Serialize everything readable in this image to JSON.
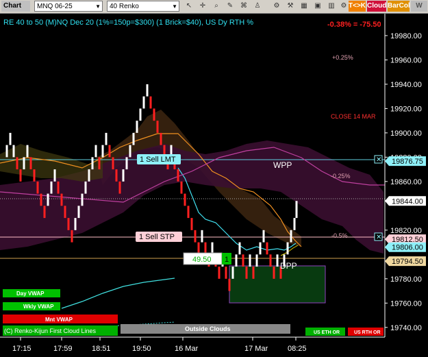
{
  "toolbar": {
    "title": "Chart",
    "symbol": "MNQ 06-25",
    "bar_type": "40 Renko",
    "chips": [
      {
        "label": "T<>K",
        "color": "#f08000"
      },
      {
        "label": "Cloud",
        "color": "#d0103a"
      },
      {
        "label": "BarCol",
        "color": "#e09000"
      },
      {
        "label": "W WVM",
        "color": "#bbbbbb"
      }
    ]
  },
  "header": {
    "study_title": "RE 40 to 50 (M)NQ Dec 20 (1%=150p=$300) (1 Brick=$40), US Dy RTH %",
    "change": "-0.38% = -75.50"
  },
  "chart_data": {
    "type": "line",
    "instrument": "MNQ 06-25",
    "ylim": [
      19732,
      19998
    ],
    "y_ticks": [
      19980,
      19960,
      19940,
      19920,
      19900,
      19880,
      19860,
      19820,
      19780,
      19760,
      19740
    ],
    "x_ticks": [
      "17:15",
      "17:59",
      "18:51",
      "19:50",
      "16 Mar",
      "17 Mar",
      "08:25"
    ],
    "price_markers": [
      {
        "label": "19876.75",
        "value": 19876.75,
        "bg": "#8ef0f8",
        "fg": "#000"
      },
      {
        "label": "19844.00",
        "value": 19844.0,
        "bg": "#ffffff",
        "fg": "#000"
      },
      {
        "label": "19812.50",
        "value": 19812.5,
        "bg": "#ffd0d8",
        "fg": "#000"
      },
      {
        "label": "19806.00",
        "value": 19806.0,
        "bg": "#8ef0f8",
        "fg": "#000"
      },
      {
        "label": "19794.50",
        "value": 19794.5,
        "bg": "#f0d8a0",
        "fg": "#000"
      }
    ],
    "annotations": [
      {
        "text": "+0.25%",
        "color": "#e0a0b0"
      },
      {
        "text": "CLOSE 14 MAR",
        "color": "#ff3030"
      },
      {
        "text": "-0.25%",
        "color": "#e0a0b0"
      },
      {
        "text": "-0.5%",
        "color": "#e0a0b0"
      },
      {
        "text": "WPP",
        "color": "#ffffff"
      },
      {
        "text": "DPP",
        "color": "#ffffff"
      }
    ],
    "orders": [
      {
        "label": "1 Sell LMT",
        "price": 19876.75
      },
      {
        "label": "1 Sell STP",
        "price": 19812.5
      }
    ],
    "position": {
      "pnl": "49.50",
      "qty": "1"
    },
    "bricks": [
      [
        10,
        19880,
        19890,
        "w"
      ],
      [
        15,
        19890,
        19900,
        "w"
      ],
      [
        20,
        19880,
        19890,
        "w"
      ],
      [
        25,
        19870,
        19880,
        "r"
      ],
      [
        30,
        19860,
        19870,
        "r"
      ],
      [
        35,
        19870,
        19880,
        "w"
      ],
      [
        40,
        19880,
        19890,
        "w"
      ],
      [
        45,
        19870,
        19880,
        "r"
      ],
      [
        50,
        19860,
        19870,
        "r"
      ],
      [
        55,
        19850,
        19860,
        "r"
      ],
      [
        60,
        19840,
        19850,
        "r"
      ],
      [
        65,
        19830,
        19840,
        "r"
      ],
      [
        70,
        19840,
        19850,
        "w"
      ],
      [
        75,
        19850,
        19860,
        "w"
      ],
      [
        80,
        19860,
        19870,
        "w"
      ],
      [
        85,
        19850,
        19860,
        "r"
      ],
      [
        90,
        19840,
        19850,
        "r"
      ],
      [
        95,
        19830,
        19840,
        "r"
      ],
      [
        100,
        19820,
        19830,
        "r"
      ],
      [
        105,
        19810,
        19820,
        "r"
      ],
      [
        110,
        19820,
        19830,
        "w"
      ],
      [
        115,
        19830,
        19840,
        "w"
      ],
      [
        120,
        19840,
        19850,
        "w"
      ],
      [
        125,
        19850,
        19860,
        "w"
      ],
      [
        130,
        19860,
        19870,
        "w"
      ],
      [
        135,
        19870,
        19880,
        "w"
      ],
      [
        140,
        19880,
        19890,
        "w"
      ],
      [
        145,
        19870,
        19880,
        "r"
      ],
      [
        150,
        19880,
        19890,
        "w"
      ],
      [
        155,
        19890,
        19900,
        "w"
      ],
      [
        160,
        19880,
        19890,
        "r"
      ],
      [
        165,
        19870,
        19880,
        "r"
      ],
      [
        170,
        19860,
        19870,
        "r"
      ],
      [
        175,
        19850,
        19860,
        "r"
      ],
      [
        180,
        19860,
        19870,
        "w"
      ],
      [
        185,
        19870,
        19880,
        "w"
      ],
      [
        190,
        19880,
        19890,
        "w"
      ],
      [
        195,
        19890,
        19900,
        "w"
      ],
      [
        200,
        19900,
        19910,
        "w"
      ],
      [
        205,
        19910,
        19920,
        "w"
      ],
      [
        210,
        19920,
        19930,
        "w"
      ],
      [
        215,
        19930,
        19940,
        "w"
      ],
      [
        220,
        19920,
        19930,
        "r"
      ],
      [
        225,
        19910,
        19920,
        "r"
      ],
      [
        230,
        19900,
        19910,
        "r"
      ],
      [
        235,
        19890,
        19900,
        "r"
      ],
      [
        240,
        19880,
        19890,
        "r"
      ],
      [
        245,
        19870,
        19880,
        "r"
      ],
      [
        250,
        19880,
        19890,
        "w"
      ],
      [
        255,
        19870,
        19880,
        "r"
      ],
      [
        260,
        19860,
        19870,
        "r"
      ],
      [
        265,
        19850,
        19860,
        "r"
      ],
      [
        270,
        19840,
        19850,
        "r"
      ],
      [
        275,
        19830,
        19840,
        "r"
      ],
      [
        280,
        19820,
        19830,
        "r"
      ],
      [
        285,
        19810,
        19820,
        "r"
      ],
      [
        290,
        19800,
        19810,
        "r"
      ],
      [
        295,
        19810,
        19820,
        "w"
      ],
      [
        300,
        19800,
        19810,
        "r"
      ],
      [
        305,
        19790,
        19800,
        "r"
      ],
      [
        310,
        19800,
        19810,
        "w"
      ],
      [
        315,
        19790,
        19800,
        "r"
      ],
      [
        320,
        19780,
        19790,
        "r"
      ],
      [
        325,
        19790,
        19800,
        "w"
      ],
      [
        330,
        19780,
        19790,
        "r"
      ],
      [
        335,
        19770,
        19780,
        "r"
      ],
      [
        340,
        19780,
        19790,
        "w"
      ],
      [
        345,
        19790,
        19800,
        "w"
      ],
      [
        350,
        19800,
        19810,
        "w"
      ],
      [
        355,
        19790,
        19800,
        "r"
      ],
      [
        360,
        19780,
        19790,
        "r"
      ],
      [
        365,
        19790,
        19800,
        "w"
      ],
      [
        370,
        19780,
        19790,
        "r"
      ],
      [
        375,
        19790,
        19800,
        "w"
      ],
      [
        380,
        19800,
        19810,
        "w"
      ],
      [
        385,
        19810,
        19820,
        "w"
      ],
      [
        390,
        19800,
        19810,
        "r"
      ],
      [
        395,
        19790,
        19800,
        "r"
      ],
      [
        400,
        19780,
        19790,
        "r"
      ],
      [
        405,
        19790,
        19800,
        "w"
      ],
      [
        410,
        19780,
        19790,
        "r"
      ],
      [
        415,
        19790,
        19800,
        "w"
      ],
      [
        420,
        19800,
        19810,
        "w"
      ],
      [
        425,
        19810,
        19820,
        "w"
      ],
      [
        430,
        19820,
        19830,
        "w"
      ],
      [
        433,
        19830,
        19844,
        "w"
      ]
    ]
  },
  "vwap_labels": [
    {
      "text": "Day VWAP",
      "bg": "#00c000"
    },
    {
      "text": "Wkly VWAP",
      "bg": "#00c000"
    },
    {
      "text": "Mnt VWAP",
      "bg": "#e00000"
    }
  ],
  "bottom_bar": {
    "study_text": "(C) Renko-Kijun First Cloud Lines",
    "clouds_button": "Outside Clouds",
    "us_eth_or": "US ETH OR",
    "us_rth_or": "US RTH OR"
  }
}
